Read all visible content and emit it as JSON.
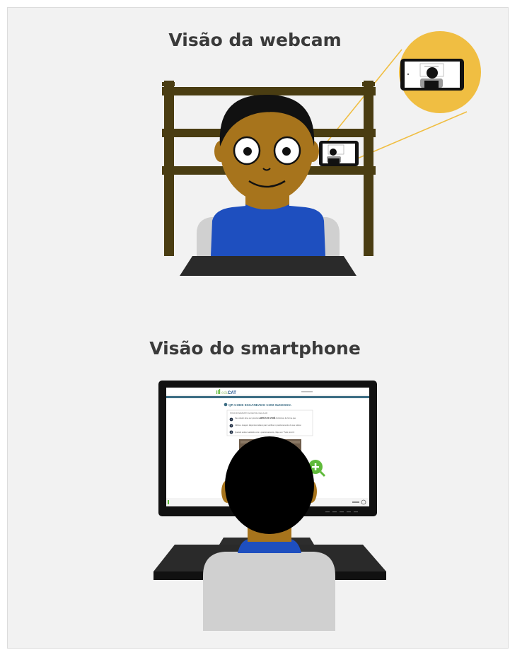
{
  "webcam_section": {
    "title": "Visão da webcam"
  },
  "smartphone_section": {
    "title": "Visão do smartphone",
    "screen": {
      "logo_prefix": "edu",
      "logo_suffix": "CAT",
      "banner": "QR CODE ESCANEADO COM SUCESSO.",
      "card_title": "POSICIONAMENTO E DEVICE CELULAR",
      "steps": [
        {
          "number": "1",
          "text_a": "Seu celular deve ser posicionado",
          "emphasis": "ATRÁS DE VOCÊ",
          "text_b": ", na horizontal, de forma que"
        },
        {
          "number": "2",
          "text_a": "Utilize a imagem disponível abaixo para verificar o posicionamento do seu celular."
        },
        {
          "number": "3",
          "text_a": "Quando estiver satisfeito com o posicionamento, clique em \"Tudo pronto\"."
        }
      ]
    }
  },
  "colors": {
    "panel_bg": "#f2f2f2",
    "shelf_wood": "#4a3d12",
    "skin": "#a7741c",
    "shirt_blue": "#1e4fbf",
    "zoom_circle": "#f0be42",
    "monitor_frame": "#111111",
    "screen_banner": "#3c6d84",
    "accent_green": "#5fba3a"
  }
}
